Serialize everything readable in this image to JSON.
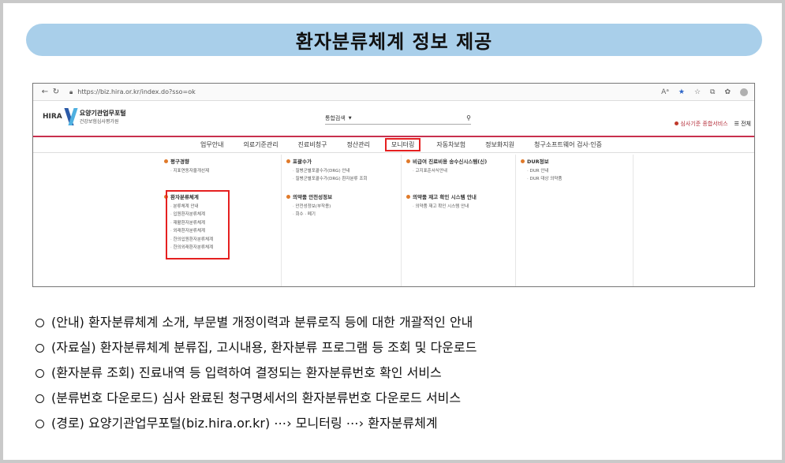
{
  "title": "환자분류체계 정보 제공",
  "browser": {
    "url": "https://biz.hira.or.kr/index.do?sso=ok",
    "reader_icon": "Aᵃ"
  },
  "site": {
    "logo_hira": "HIRA",
    "logo_title": "요양기관업무포털",
    "logo_subtitle": "건강보험심사평가원",
    "search_label": "통합검색",
    "header_link": "심사기준 종합서비스",
    "all_menu": "☰ 전체"
  },
  "gnb": [
    "업무안내",
    "의료기준관리",
    "진료비청구",
    "정산관리",
    "모니터링",
    "자동차보험",
    "정보화지원",
    "청구소프트웨어 검사·인증"
  ],
  "mega": {
    "col1": [
      {
        "head": "평구경향",
        "items": [
          "지표연동자율개선제"
        ]
      },
      {
        "head": "환자분류체계",
        "items": [
          "분류체계 안내",
          "입원환자분류체계",
          "재활환자분류체계",
          "외래환자분류체계",
          "한의입원환자분류체계",
          "한의외래환자분류체계"
        ]
      }
    ],
    "col2": [
      {
        "head": "포괄수가",
        "items": [
          "질병군별포괄수가(DRG) 안내",
          "질병군별포괄수가(DRG) 환자분류 조회"
        ]
      },
      {
        "head": "의약품 안전성정보",
        "items": [
          "안전성정보(부작용)",
          "회수 · 폐기"
        ]
      }
    ],
    "col3": [
      {
        "head": "비급여 진료비용 송수신시스템(신)",
        "items": [
          "고지표준서식안내"
        ]
      },
      {
        "head": "의약품 재고 확인 시스템 안내",
        "items": [
          "의약품 재고 확인 시스템 안내"
        ]
      }
    ],
    "col4": [
      {
        "head": "DUR정보",
        "items": [
          "DUR 안내",
          "DUR 대상 의약품"
        ]
      }
    ]
  },
  "notes": [
    "(안내) 환자분류체계 소개, 부문별 개정이력과 분류로직 등에 대한 개괄적인 안내",
    "(자료실) 환자분류체계 분류집, 고시내용, 환자분류 프로그램 등 조회 및 다운로드",
    "(환자분류 조회) 진료내역 등 입력하여 결정되는 환자분류번호 확인 서비스",
    "(분류번호 다운로드) 심사 완료된 청구명세서의 환자분류번호 다운로드 서비스",
    "(경로) 요양기관업무포털(biz.hira.or.kr) ⋯› 모니터링 ⋯› 환자분류체계"
  ],
  "colors": {
    "banner": "#a9cfea",
    "highlight": "#e52020",
    "nav_line": "#c8304e"
  }
}
